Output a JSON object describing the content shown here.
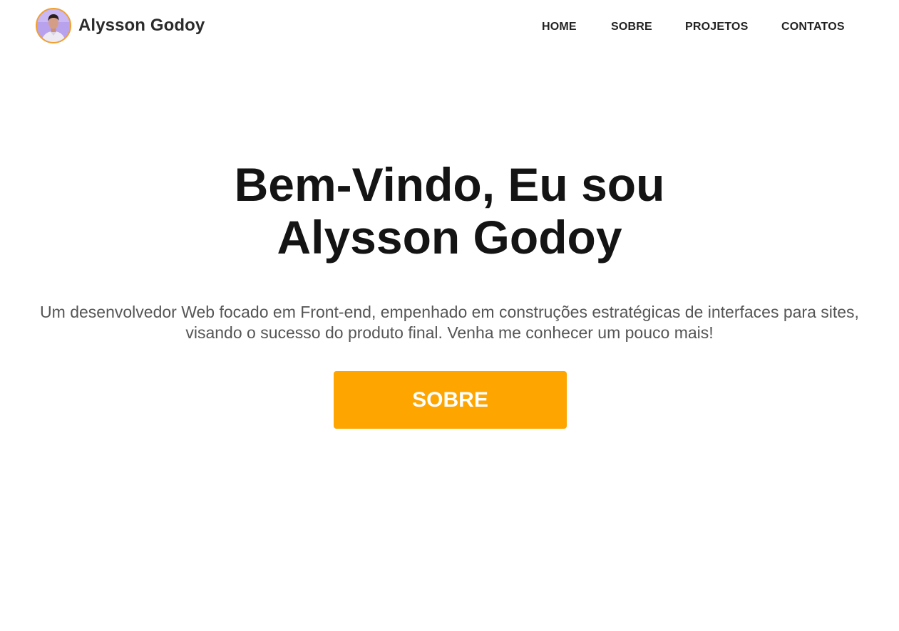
{
  "header": {
    "brand_name": "Alysson Godoy",
    "avatar_icon": "profile-photo",
    "nav": {
      "home": "HOME",
      "sobre": "SOBRE",
      "projetos": "PROJETOS",
      "contatos": "CONTATOS"
    }
  },
  "hero": {
    "title_line1": "Bem-Vindo, Eu sou",
    "title_line2": "Alysson Godoy",
    "subtitle_line1": "Um desenvolvedor Web focado em Front-end, empenhado em construções estratégicas de interfaces para sites,",
    "subtitle_line2": "visando o sucesso do produto final. Venha me conhecer um pouco mais!",
    "cta_label": "SOBRE"
  },
  "colors": {
    "accent": "#ffa500",
    "avatar_ring": "#f0a030",
    "heading": "#141414",
    "body_text": "#555555",
    "nav_text": "#222222",
    "background": "#ffffff"
  }
}
